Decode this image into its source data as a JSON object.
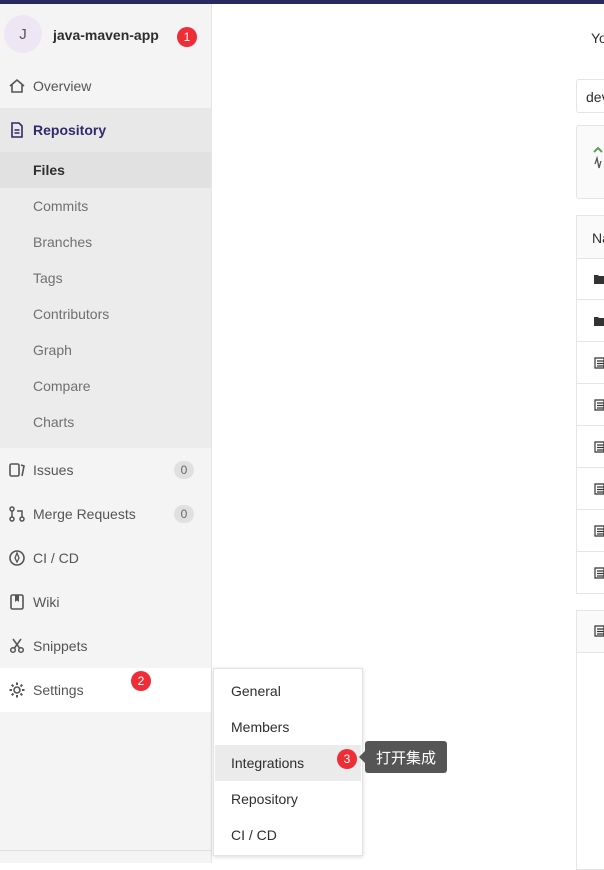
{
  "project": {
    "avatar_letter": "J",
    "name": "java-maven-app"
  },
  "markers": {
    "m1": "1",
    "m2": "2",
    "m3": "3"
  },
  "nav": {
    "overview": "Overview",
    "repository": "Repository",
    "repo_sub": [
      "Files",
      "Commits",
      "Branches",
      "Tags",
      "Contributors",
      "Graph",
      "Compare",
      "Charts"
    ],
    "issues": "Issues",
    "issues_count": "0",
    "merge_requests": "Merge Requests",
    "merge_requests_count": "0",
    "ci_cd": "CI / CD",
    "wiki": "Wiki",
    "snippets": "Snippets",
    "settings": "Settings"
  },
  "settings_menu": [
    "General",
    "Members",
    "Integrations",
    "Repository",
    "CI / CD"
  ],
  "tooltip": "打开集成",
  "main": {
    "top_text": "Yo",
    "branch_text": "dev",
    "table_header": "Na"
  },
  "colors": {
    "accent": "#2f2a6b",
    "marker_red": "#ee2d36",
    "topbar": "#292961"
  }
}
